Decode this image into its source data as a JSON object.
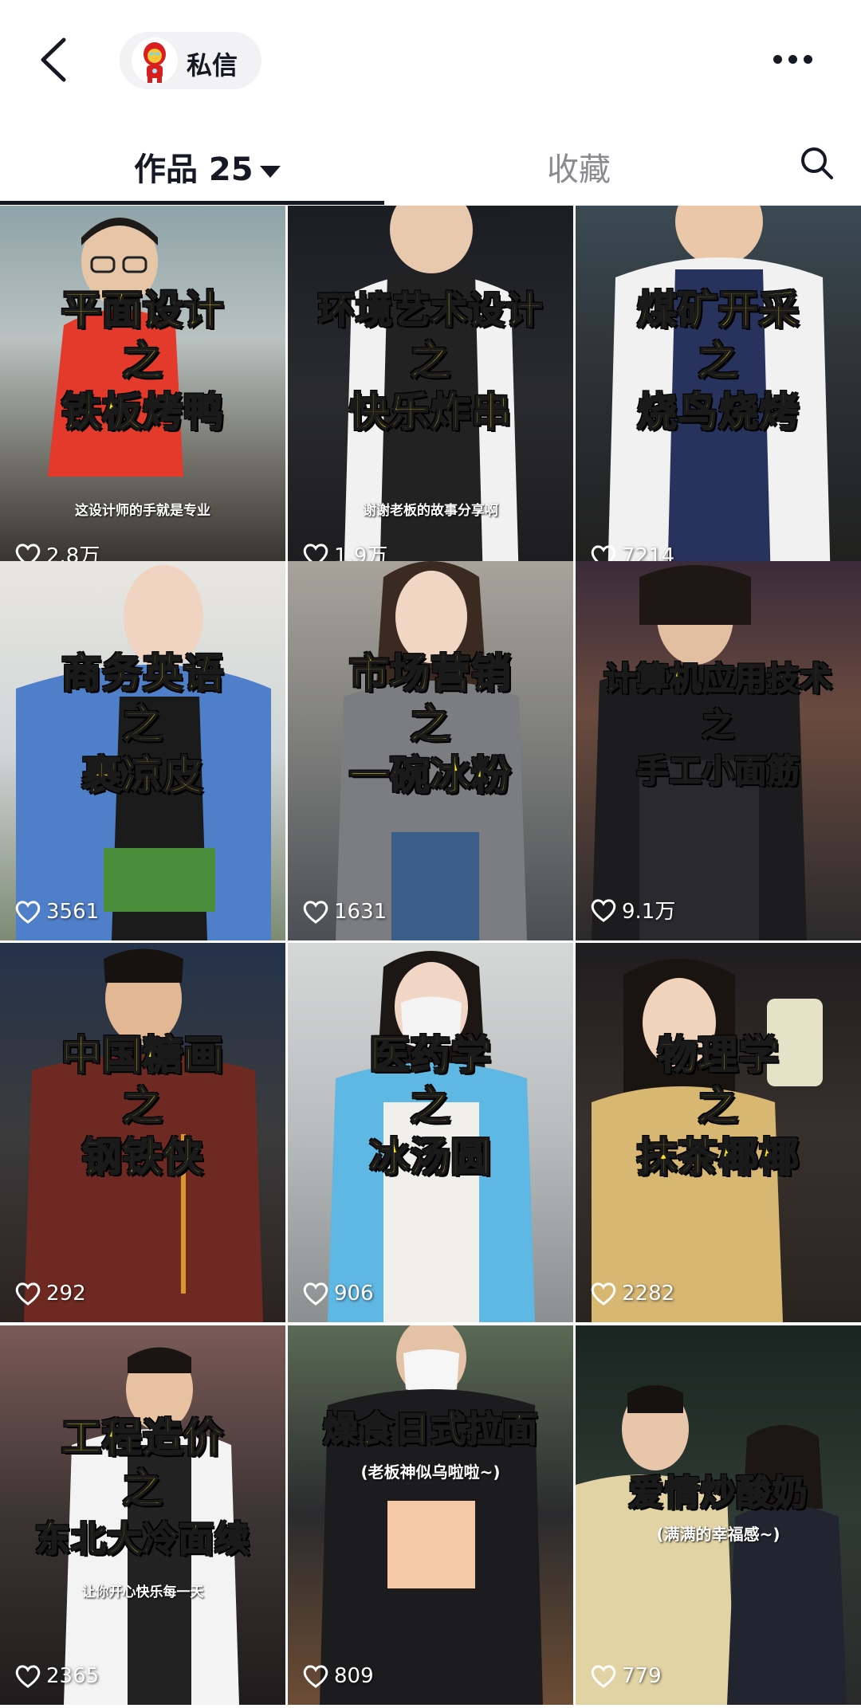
{
  "header": {
    "dm_label": "私信"
  },
  "tabs": {
    "works_label": "作品 25",
    "collect_label": "收藏"
  },
  "videos": [
    {
      "title": [
        "平面设计",
        "之",
        "铁板烤鸭"
      ],
      "subtitle": "这设计师的手就是专业",
      "likes": "2.8万"
    },
    {
      "title": [
        "环境艺术设计",
        "之",
        "快乐炸串"
      ],
      "subtitle": "谢谢老板的故事分享啊",
      "likes": "1.9万"
    },
    {
      "title": [
        "煤矿开采",
        "之",
        "烧鸟烧烤"
      ],
      "subtitle": "",
      "likes": "7214"
    },
    {
      "title": [
        "商务英语",
        "之",
        "裹凉皮"
      ],
      "subtitle": "",
      "likes": "3561"
    },
    {
      "title": [
        "市场营销",
        "之",
        "一碗冰粉"
      ],
      "subtitle": "",
      "likes": "1631"
    },
    {
      "title": [
        "计算机应用技术",
        "之",
        "手工小面筋"
      ],
      "subtitle": "",
      "likes": "9.1万"
    },
    {
      "title": [
        "中国糖画",
        "之",
        "钢铁侠"
      ],
      "subtitle": "",
      "likes": "292"
    },
    {
      "title": [
        "医药学",
        "之",
        "冰汤圆"
      ],
      "subtitle": "",
      "likes": "906"
    },
    {
      "title": [
        "物理学",
        "之",
        "抹茶椰椰"
      ],
      "subtitle": "",
      "likes": "2282"
    },
    {
      "title": [
        "工程造价",
        "之",
        "东北大冷面续"
      ],
      "subtitle": "让你开心快乐每一天",
      "likes": "2365"
    },
    {
      "title": [
        "燥食日式拉面",
        "(老板神似乌啦啦~)"
      ],
      "subtitle": "",
      "likes": "809"
    },
    {
      "title": [
        "爱情炒酸奶",
        "(满满的幸福感~)"
      ],
      "subtitle": "",
      "likes": "779"
    }
  ],
  "colors": {
    "caption_yellow": "#ffe61a",
    "text_dark": "#161823",
    "text_muted": "#8a8b91"
  }
}
